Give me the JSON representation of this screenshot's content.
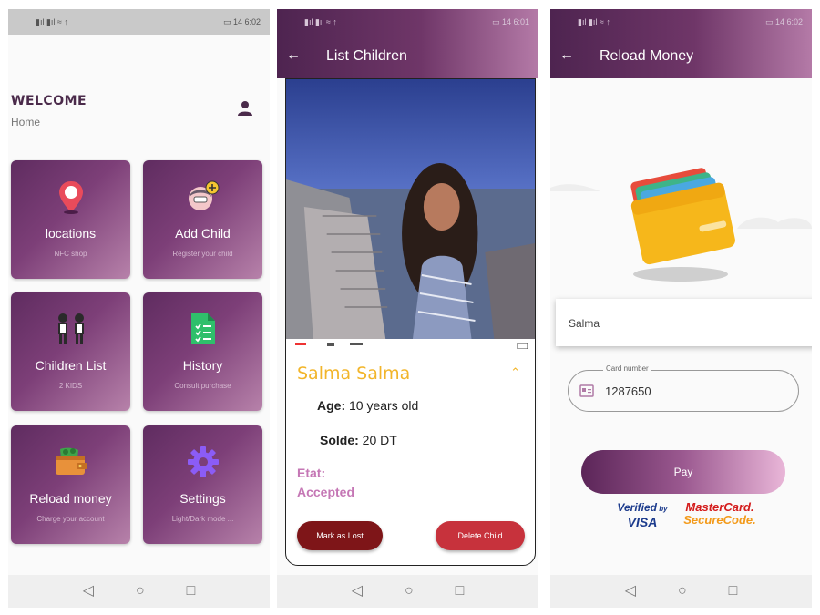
{
  "home": {
    "status": {
      "left": "▮ıl ▮ıl ≈ ↑",
      "right": "▭ 14 6:02"
    },
    "welcome": "WELCOME",
    "subtitle": "Home",
    "tiles": [
      {
        "title": "locations",
        "sub": "NFC shop",
        "icon": "location-pin-icon"
      },
      {
        "title": "Add Child",
        "sub": "Register your child",
        "icon": "add-child-icon"
      },
      {
        "title": "Children List",
        "sub": "2 KIDS",
        "icon": "children-icon"
      },
      {
        "title": "History",
        "sub": "Consult purchase",
        "icon": "checklist-icon"
      },
      {
        "title": "Reload money",
        "sub": "Charge your account",
        "icon": "wallet-icon"
      },
      {
        "title": "Settings",
        "sub": "Light/Dark mode ...",
        "icon": "gear-icon"
      }
    ]
  },
  "children": {
    "status": {
      "left": "▮ıl ▮ıl ≈ ↑",
      "right": "▭ 14 6:01"
    },
    "title": "List Children",
    "child_name": "Salma Salma",
    "age_label": "Age:",
    "age_value": "10 years old",
    "solde_label": "Solde:",
    "solde_value": "20 DT",
    "etat_label": "Etat:",
    "etat_value": "Accepted",
    "lost_button": "Mark as Lost",
    "delete_button": "Delete Child"
  },
  "reload": {
    "status": {
      "left": "▮ıl ▮ıl ≈ ↑",
      "right": "▭ 14 6:02"
    },
    "title": "Reload Money",
    "name": "Salma",
    "card_label": "Card number",
    "card_value": "1287650",
    "pay_button": "Pay",
    "verified_line1": "Verified",
    "verified_by": "by",
    "verified_line2": "VISA",
    "mastercard_line1": "MasterCard.",
    "mastercard_line2": "SecureCode."
  },
  "nav": {
    "back": "◁",
    "home": "○",
    "recents": "□",
    "arrow_back": "←",
    "chevron_up": "⌃"
  },
  "colors": {
    "brand_purple": "#6f3668",
    "accent_yellow": "#f2b52a",
    "lost_red": "#7e1518",
    "delete_red": "#c7323c"
  }
}
